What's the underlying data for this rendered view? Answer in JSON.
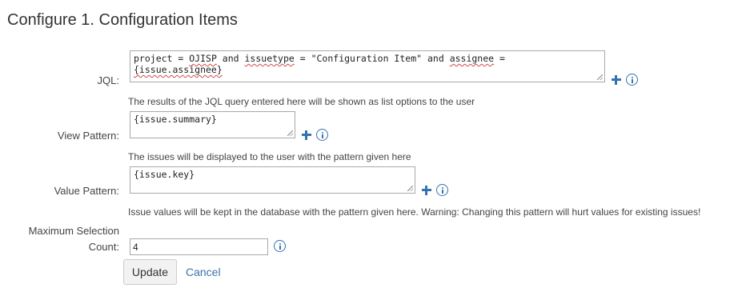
{
  "page": {
    "title": "Configure 1. Configuration Items"
  },
  "jql": {
    "label": "JQL:",
    "value_line1_a": "project = ",
    "value_line1_b": "OJISP",
    "value_line1_c": " and ",
    "value_line1_d": "issuetype",
    "value_line1_e": " = \"Configuration Item\" and ",
    "value_line1_f": "assignee",
    "value_line1_g": " =",
    "value_line2": "{issue.assignee}",
    "help": "The results of the JQL query entered here will be shown as list options to the user"
  },
  "view_pattern": {
    "label": "View Pattern:",
    "value": "{issue.summary}",
    "help": "The issues will be displayed to the user with the pattern given here"
  },
  "value_pattern": {
    "label": "Value Pattern:",
    "value": "{issue.key}",
    "help": "Issue values will be kept in the database with the pattern given here. Warning: Changing this pattern will hurt values for existing issues!"
  },
  "max_selection": {
    "label_line1": "Maximum Selection",
    "label_line2": "Count:",
    "value": "4"
  },
  "actions": {
    "update": "Update",
    "cancel": "Cancel"
  },
  "icons": {
    "add": "plus-icon",
    "info": "info-icon"
  },
  "colors": {
    "accent": "#3572b0",
    "link": "#3b73af"
  }
}
